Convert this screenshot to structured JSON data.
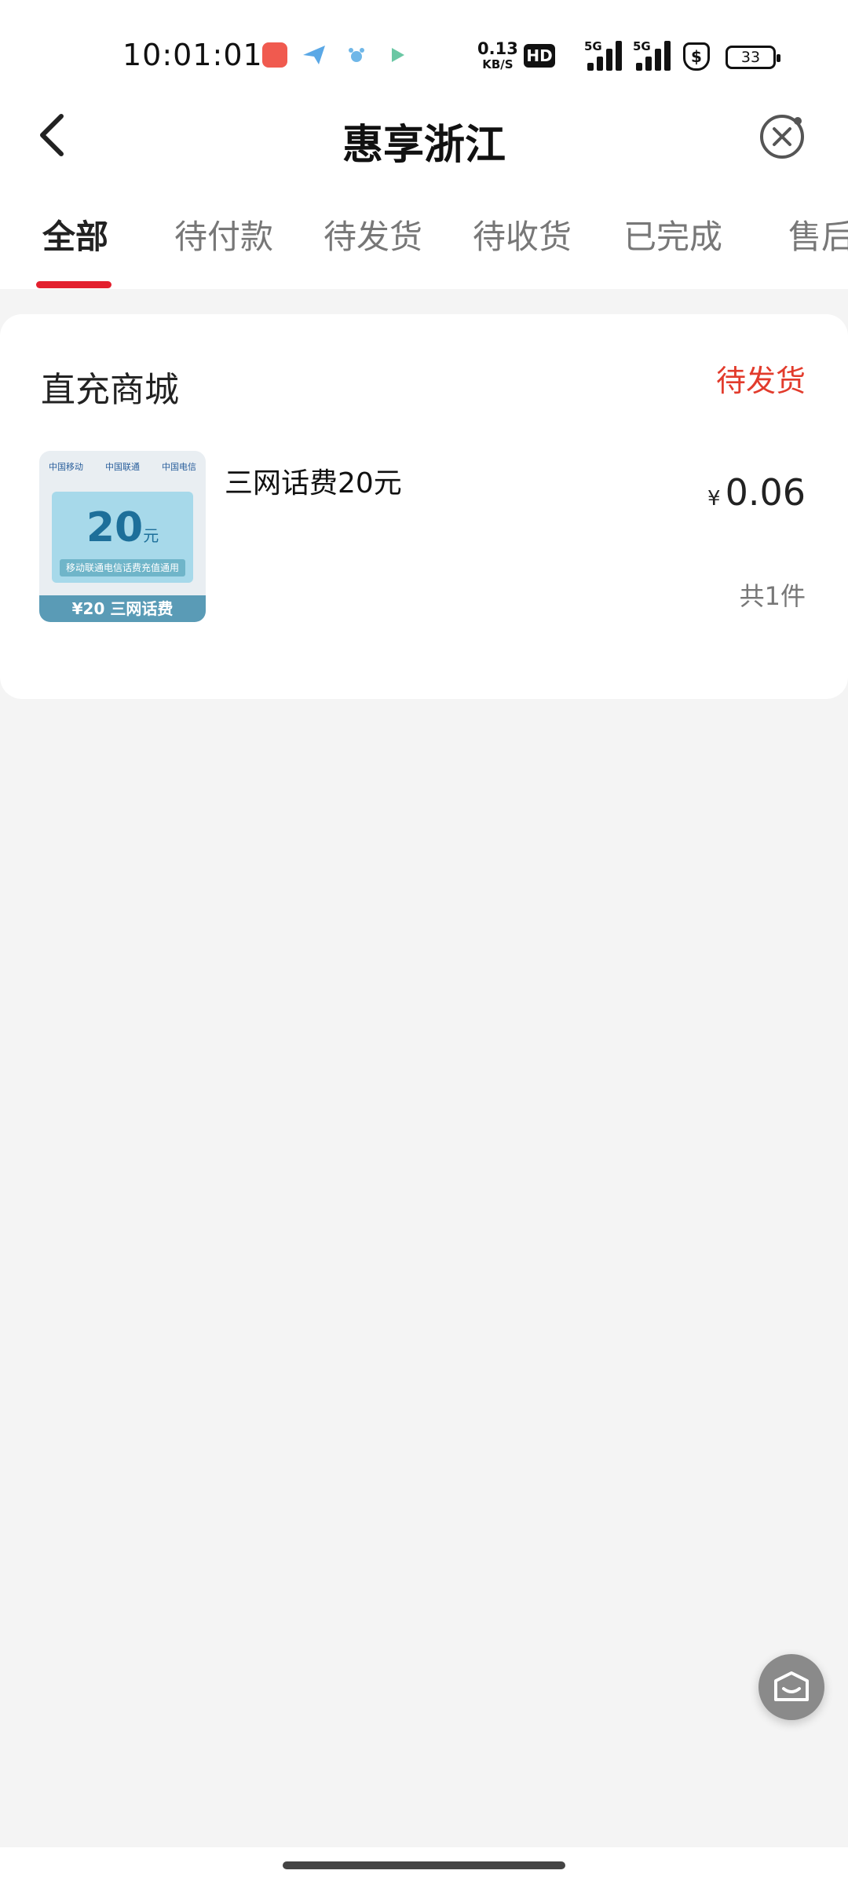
{
  "status_bar": {
    "time": "10:01:01",
    "net_speed": "0.13",
    "net_unit": "KB/S",
    "hd": "HD",
    "sim1": "5G",
    "sim2": "5G",
    "shield": "$",
    "battery": "33"
  },
  "header": {
    "title": "惠享浙江"
  },
  "tabs": [
    {
      "label": "全部",
      "active": true
    },
    {
      "label": "待付款"
    },
    {
      "label": "待发货"
    },
    {
      "label": "待收货"
    },
    {
      "label": "已完成"
    },
    {
      "label": "售后"
    }
  ],
  "order": {
    "shop": "直充商城",
    "status": "待发货",
    "product_name": "三网话费20元",
    "currency": "¥",
    "price": "0.06",
    "quantity": "共1件",
    "thumb": {
      "logo1": "中国移动",
      "logo2": "中国联通",
      "logo3": "中国电信",
      "amount": "20",
      "amount_unit": "元",
      "note": "移动联通电信话费充值通用",
      "footer": "¥20 三网话费"
    }
  },
  "colors": {
    "accent": "#e3202e",
    "status": "#e23b2c"
  }
}
